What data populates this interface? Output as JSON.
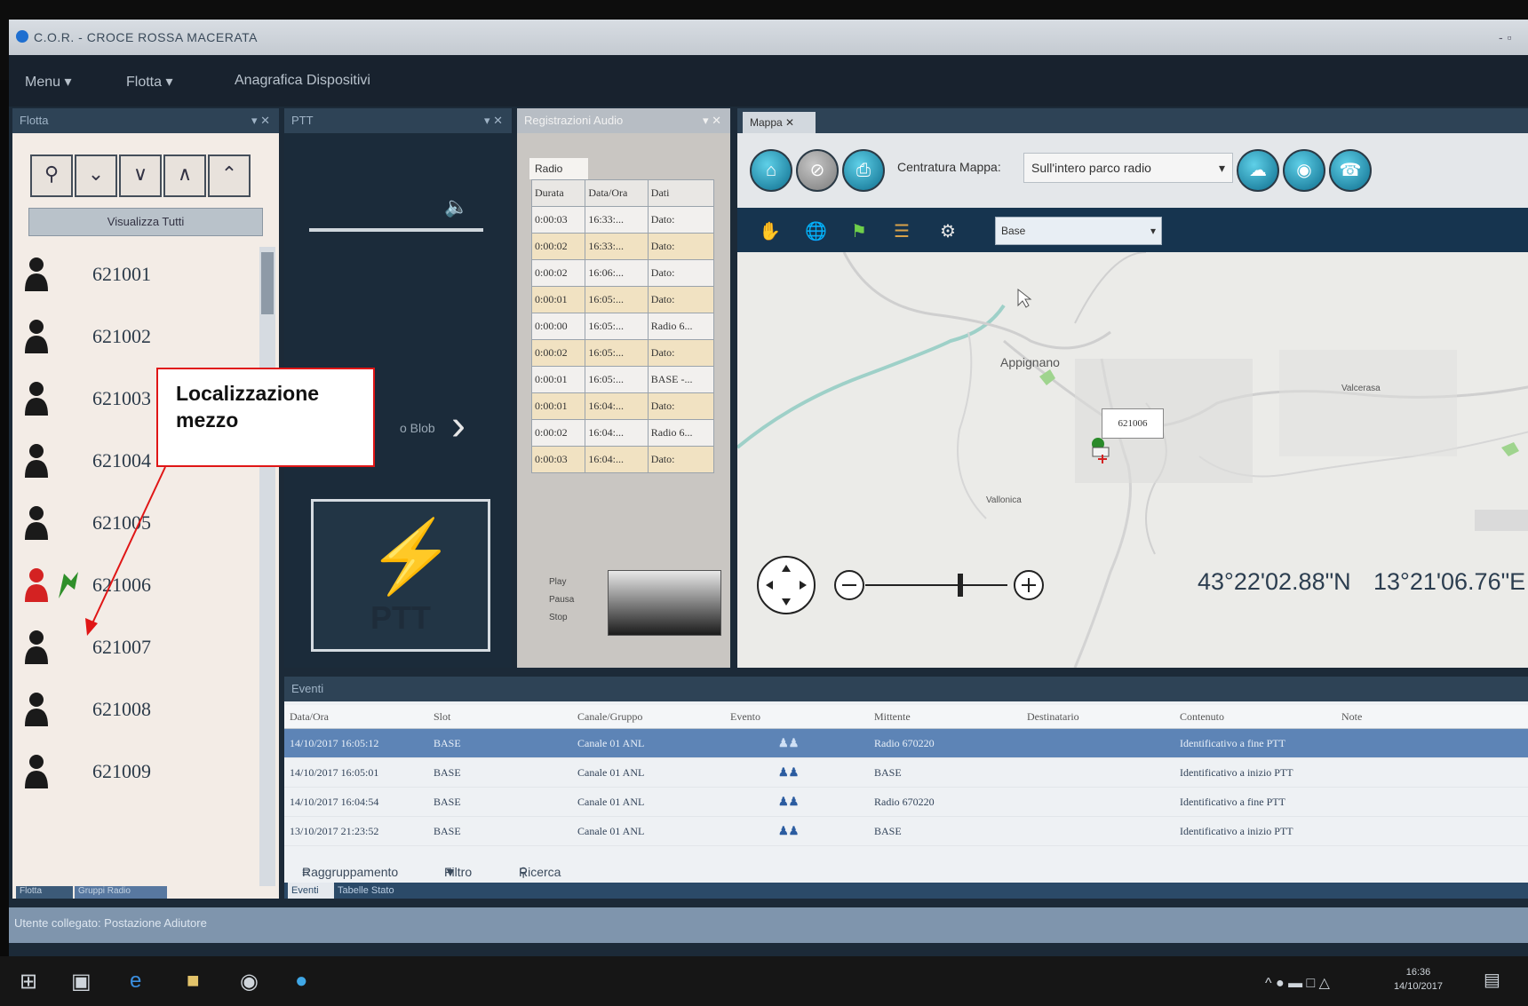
{
  "app": {
    "title": "C.O.R. - CROCE ROSSA MACERATA",
    "window_controls": "- ▫"
  },
  "menu": {
    "items": [
      "Menu ▾",
      "Flotta ▾",
      "Anagrafica Dispositivi"
    ]
  },
  "fleet_panel": {
    "header": "Flotta",
    "view_all_label": "Visualizza Tutti",
    "units": [
      {
        "label": "621001",
        "color": "#1a1a1a",
        "located": false
      },
      {
        "label": "621002",
        "color": "#1a1a1a",
        "located": false
      },
      {
        "label": "621003",
        "color": "#1a1a1a",
        "located": false
      },
      {
        "label": "621004",
        "color": "#1a1a1a",
        "located": false
      },
      {
        "label": "621005",
        "color": "#1a1a1a",
        "located": false
      },
      {
        "label": "621006",
        "color": "#d42222",
        "located": true
      },
      {
        "label": "621007",
        "color": "#1a1a1a",
        "located": false
      },
      {
        "label": "621008",
        "color": "#1a1a1a",
        "located": false
      },
      {
        "label": "621009",
        "color": "#1a1a1a",
        "located": false
      }
    ],
    "bottom_tabs": [
      "Flotta",
      "Gruppi Radio"
    ]
  },
  "ptt_panel": {
    "header": "PTT",
    "side_text": "o Blob",
    "button_label": "PTT"
  },
  "audio_panel": {
    "header": "Registrazioni Audio",
    "tab": "Radio",
    "columns": [
      "Durata",
      "Data/Ora",
      "Dati"
    ],
    "rows": [
      [
        "0:00:03",
        "16:33:...",
        "Dato:"
      ],
      [
        "0:00:02",
        "16:33:...",
        "Dato:"
      ],
      [
        "0:00:02",
        "16:06:...",
        "Dato:"
      ],
      [
        "0:00:01",
        "16:05:...",
        "Dato:"
      ],
      [
        "0:00:00",
        "16:05:...",
        "Radio 6..."
      ],
      [
        "0:00:02",
        "16:05:...",
        "Dato:"
      ],
      [
        "0:00:01",
        "16:05:...",
        "BASE -..."
      ],
      [
        "0:00:01",
        "16:04:...",
        "Dato:"
      ],
      [
        "0:00:02",
        "16:04:...",
        "Radio 6..."
      ],
      [
        "0:00:03",
        "16:04:...",
        "Dato:"
      ]
    ],
    "player_controls": [
      "Play",
      "Pausa",
      "Stop"
    ]
  },
  "map_panel": {
    "tab": "Mappa",
    "centering_label": "Centratura Mappa:",
    "centering_value": "Sull'intero parco radio",
    "layer_value": "Base",
    "town_labels": [
      "Appignano",
      "Vallonica",
      "Valcerasa"
    ],
    "marker_label": "621006",
    "coords_lat": "43°22'02.88\"N",
    "coords_lon": "13°21'06.76\"E"
  },
  "events_panel": {
    "header": "Eventi",
    "columns": [
      "Data/Ora",
      "Slot",
      "Canale/Gruppo",
      "Evento",
      "Mittente",
      "Destinatario",
      "Contenuto",
      "Note"
    ],
    "rows": [
      [
        "14/10/2017 16:05:12",
        "BASE",
        "Canale 01 ANL",
        "",
        "Radio 670220",
        "",
        "Identificativo a fine PTT",
        ""
      ],
      [
        "14/10/2017 16:05:01",
        "BASE",
        "Canale 01 ANL",
        "",
        "BASE",
        "",
        "Identificativo a inizio PTT",
        ""
      ],
      [
        "14/10/2017 16:04:54",
        "BASE",
        "Canale 01 ANL",
        "",
        "Radio 670220",
        "",
        "Identificativo a fine PTT",
        ""
      ],
      [
        "13/10/2017 21:23:52",
        "BASE",
        "Canale 01 ANL",
        "",
        "BASE",
        "",
        "Identificativo a inizio PTT",
        ""
      ]
    ],
    "tools": [
      "Raggruppamento",
      "Filtro",
      "Ricerca"
    ],
    "bottom_tabs": [
      "Eventi",
      "Tabelle Stato"
    ]
  },
  "status_bar": {
    "text": "Utente collegato: Postazione Adiutore"
  },
  "taskbar": {
    "time": "16:36",
    "date": "14/10/2017"
  },
  "annotation": {
    "text": "Localizzazione mezzo"
  }
}
